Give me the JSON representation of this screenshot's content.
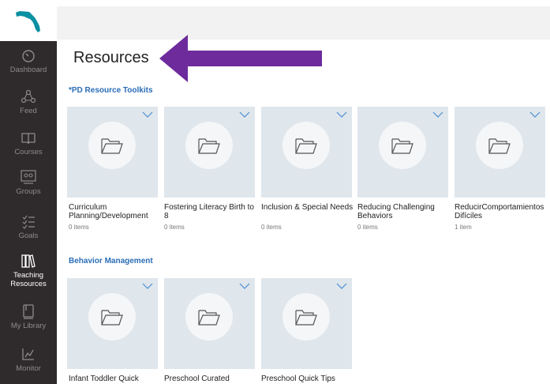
{
  "sidebar": {
    "items": [
      {
        "label": "Dashboard",
        "icon": "dashboard-icon"
      },
      {
        "label": "Feed",
        "icon": "feed-icon"
      },
      {
        "label": "Courses",
        "icon": "book-icon"
      },
      {
        "label": "Groups",
        "icon": "groups-icon"
      },
      {
        "label": "Goals",
        "icon": "goals-icon"
      },
      {
        "label": "Teaching Resources",
        "icon": "teaching-resources-icon"
      },
      {
        "label": "My Library",
        "icon": "library-icon"
      },
      {
        "label": "Monitor",
        "icon": "monitor-icon"
      }
    ],
    "active": "Teaching Resources"
  },
  "main": {
    "title": "Resources",
    "sections": [
      {
        "title": "*PD Resource Toolkits",
        "cards": [
          {
            "title": "Curriculum Planning/Development",
            "count": "0 items"
          },
          {
            "title": "Fostering Literacy Birth to 8",
            "count": "0 items"
          },
          {
            "title": "Inclusion & Special Needs",
            "count": "0 items"
          },
          {
            "title": "Reducing Challenging Behaviors",
            "count": "0 items"
          },
          {
            "title": "ReducirComportamientos Difíciles",
            "count": "1 item"
          }
        ]
      },
      {
        "title": "Behavior Management",
        "cards": [
          {
            "title": "Infant Toddler Quick",
            "count": ""
          },
          {
            "title": "Preschool Curated",
            "count": ""
          },
          {
            "title": "Preschool Quick Tips",
            "count": ""
          }
        ]
      }
    ]
  },
  "colors": {
    "sidebar_bg": "#2f2a2b",
    "link_blue": "#2a6db7",
    "card_bg": "#dfe6ec",
    "arrow_purple": "#6d2b9c"
  }
}
